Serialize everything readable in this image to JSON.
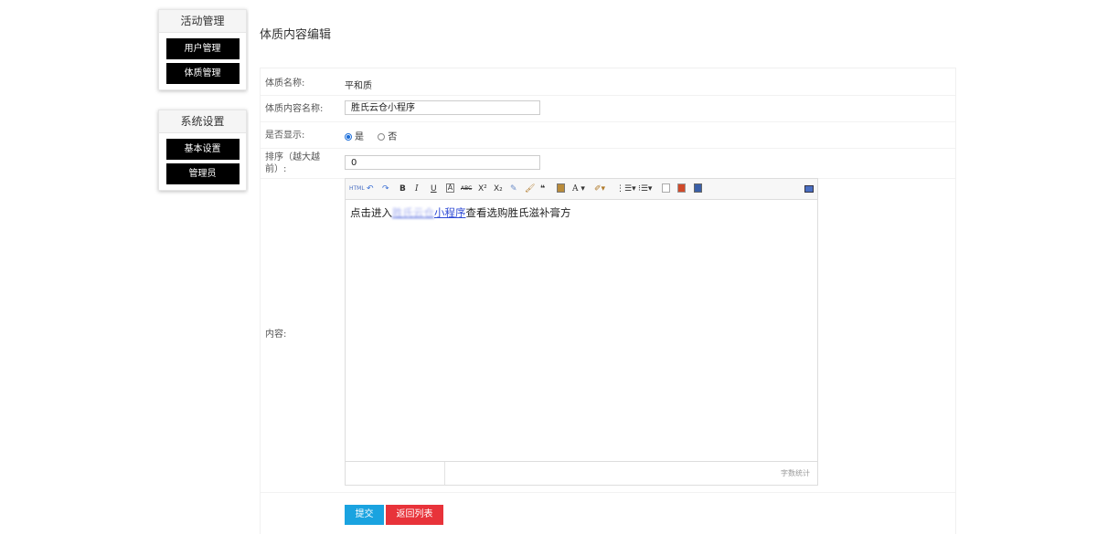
{
  "sidebar": {
    "groups": [
      {
        "title": "活动管理",
        "items": [
          "用户管理",
          "体质管理"
        ]
      },
      {
        "title": "系统设置",
        "items": [
          "基本设置",
          "管理员"
        ]
      }
    ]
  },
  "page": {
    "title": "体质内容编辑"
  },
  "form": {
    "constitution_name_label": "体质名称:",
    "constitution_name_value": "平和质",
    "content_name_label": "体质内容名称:",
    "content_name_value": "胜氏云仓小程序",
    "show_label": "是否显示:",
    "show_yes": "是",
    "show_no": "否",
    "show_selected": "是",
    "sort_label": "排序（越大越前）:",
    "sort_value": "0",
    "content_label": "内容:"
  },
  "editor": {
    "toolbar_icons": [
      "html-icon",
      "undo-icon",
      "redo-icon",
      "bold-icon",
      "italic-icon",
      "underline-icon",
      "font-border-icon",
      "strikethrough-icon",
      "superscript-icon",
      "subscript-icon",
      "eraser-icon",
      "format-brush-icon",
      "quote-icon",
      "paste-plain-icon",
      "font-color-icon",
      "bg-color-icon",
      "ordered-list-icon",
      "unordered-list-icon",
      "page-icon",
      "image-icon",
      "video-icon",
      "fullscreen-icon"
    ],
    "text_prefix": "点击进入",
    "link_hidden": "胜氏云仓",
    "link_visible": "小程序",
    "text_suffix": "查看选购胜氏滋补膏方",
    "word_count": "字数统计"
  },
  "buttons": {
    "submit": "提交",
    "back": "返回列表"
  },
  "colors": {
    "submit": "#1aa3e0",
    "back": "#e8333a",
    "sidebar_btn": "#000000"
  }
}
